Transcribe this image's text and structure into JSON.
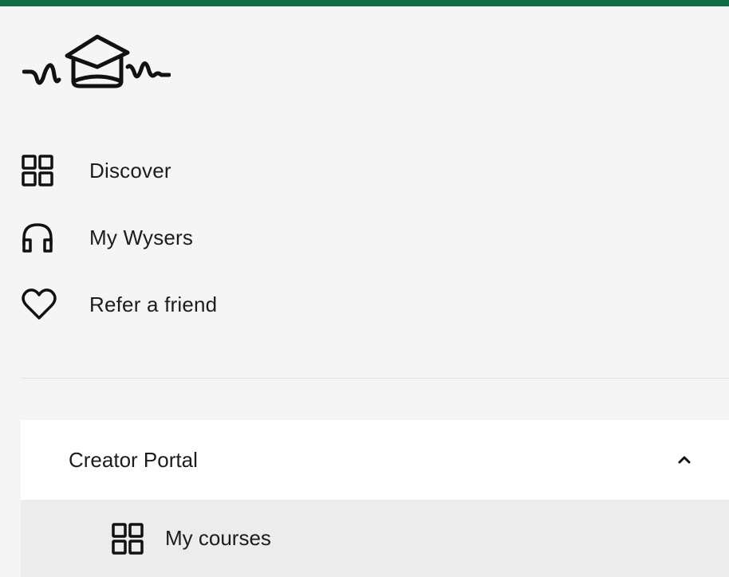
{
  "brand": {
    "accent_color": "#0f6b45",
    "logo_icon": "graduation-cap-waveform-logo"
  },
  "nav": {
    "items": [
      {
        "label": "Discover",
        "icon": "grid-icon"
      },
      {
        "label": "My Wysers",
        "icon": "headphones-icon"
      },
      {
        "label": "Refer a friend",
        "icon": "heart-icon"
      }
    ]
  },
  "creator_portal": {
    "label": "Creator Portal",
    "expanded": true,
    "toggle_icon": "chevron-up-icon",
    "items": [
      {
        "label": "My courses",
        "icon": "grid-icon"
      }
    ]
  }
}
